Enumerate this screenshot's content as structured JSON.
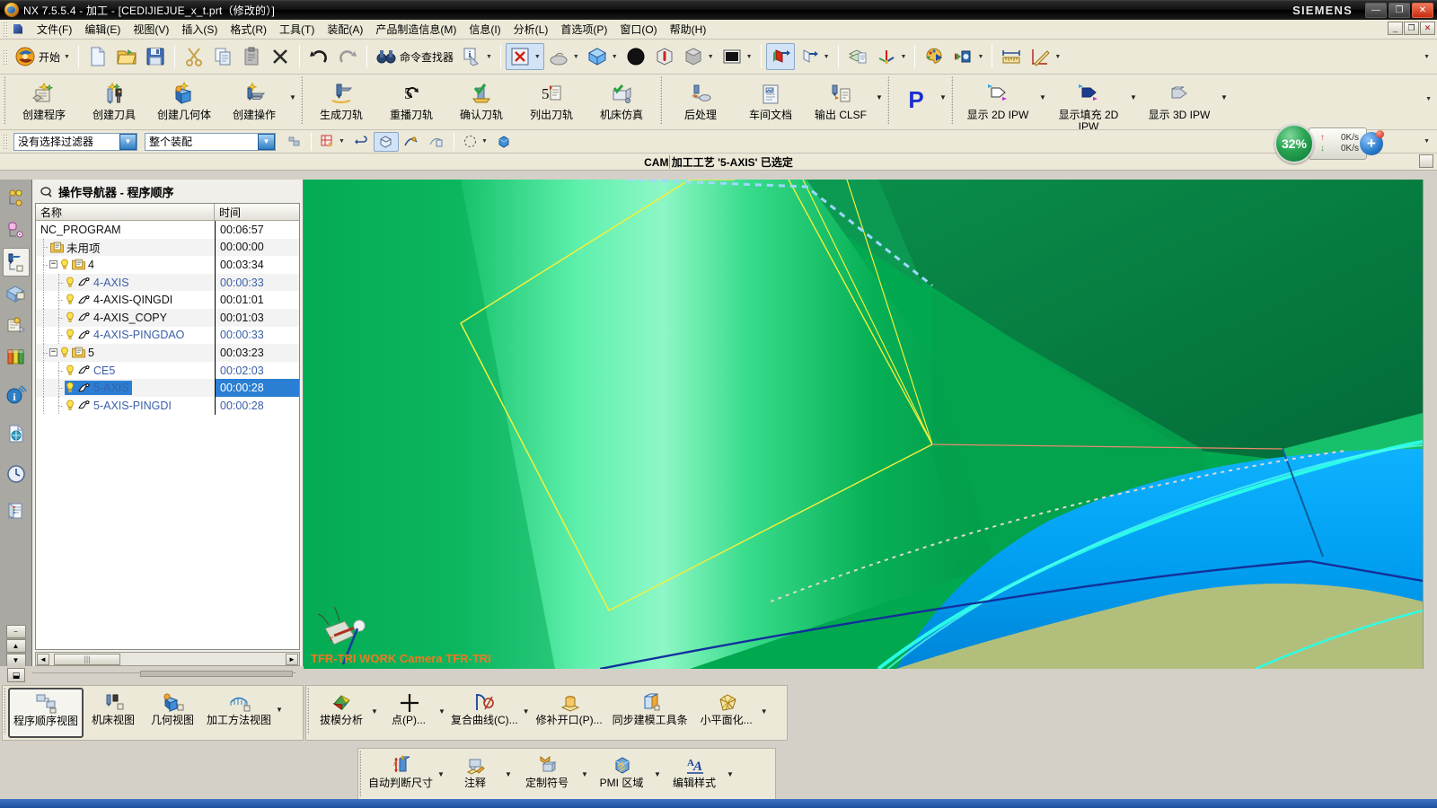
{
  "window": {
    "title": "NX 7.5.5.4 - 加工 - [CEDIJIEJUE_x_t.prt（修改的）]",
    "brand": "SIEMENS",
    "buttons": {
      "minimize": "—",
      "restore": "❐",
      "close": "✕"
    },
    "doc_buttons": {
      "minimize": "_",
      "restore": "❐",
      "close": "✕"
    }
  },
  "menubar": {
    "items": [
      {
        "label": "文件(F)"
      },
      {
        "label": "编辑(E)"
      },
      {
        "label": "视图(V)"
      },
      {
        "label": "插入(S)"
      },
      {
        "label": "格式(R)"
      },
      {
        "label": "工具(T)"
      },
      {
        "label": "装配(A)"
      },
      {
        "label": "产品制造信息(M)"
      },
      {
        "label": "信息(I)"
      },
      {
        "label": "分析(L)"
      },
      {
        "label": "首选项(P)"
      },
      {
        "label": "窗口(O)"
      },
      {
        "label": "帮助(H)"
      }
    ]
  },
  "toolbar_standard": {
    "start_label": "开始",
    "command_finder_label": "命令查找器",
    "items": [
      {
        "name": "start-menu",
        "label": "开始"
      },
      {
        "name": "new-file",
        "label": ""
      },
      {
        "name": "open-file",
        "label": ""
      },
      {
        "name": "save-file",
        "label": ""
      },
      {
        "name": "cut",
        "label": ""
      },
      {
        "name": "copy",
        "label": ""
      },
      {
        "name": "paste",
        "label": ""
      },
      {
        "name": "delete",
        "label": ""
      },
      {
        "name": "undo",
        "label": ""
      },
      {
        "name": "redo",
        "label": ""
      },
      {
        "name": "command-finder",
        "label": "命令查找器"
      },
      {
        "name": "info",
        "label": ""
      }
    ]
  },
  "ribbon": {
    "groups": [
      {
        "name": "create-group",
        "buttons": [
          {
            "icon": "create-program-icon",
            "label": "创建程序"
          },
          {
            "icon": "create-tool-icon",
            "label": "创建刀具"
          },
          {
            "icon": "create-geometry-icon",
            "label": "创建几何体"
          },
          {
            "icon": "create-operation-icon",
            "label": "创建操作"
          }
        ]
      },
      {
        "name": "toolpath-group",
        "buttons": [
          {
            "icon": "generate-toolpath-icon",
            "label": "生成刀轨"
          },
          {
            "icon": "replay-toolpath-icon",
            "label": "重播刀轨"
          },
          {
            "icon": "verify-toolpath-icon",
            "label": "确认刀轨"
          },
          {
            "icon": "list-toolpath-icon",
            "label": "列出刀轨"
          },
          {
            "icon": "machine-simulation-icon",
            "label": "机床仿真"
          }
        ]
      },
      {
        "name": "output-group",
        "buttons": [
          {
            "icon": "postprocess-icon",
            "label": "后处理"
          },
          {
            "icon": "shop-documentation-icon",
            "label": "车间文档"
          },
          {
            "icon": "output-clsf-icon",
            "label": "输出 CLSF"
          }
        ]
      },
      {
        "name": "parallel-group",
        "buttons": [
          {
            "icon": "parallel-generate-icon",
            "label": ""
          }
        ]
      },
      {
        "name": "ipw-group",
        "buttons": [
          {
            "icon": "show-2d-ipw-icon",
            "label": "显示 2D IPW"
          },
          {
            "icon": "show-filled-2d-ipw-icon",
            "label": "显示填充 2D IPW"
          },
          {
            "icon": "show-3d-ipw-icon",
            "label": "显示 3D IPW"
          }
        ]
      }
    ]
  },
  "filterbar": {
    "selection_filter": {
      "value": "没有选择过滤器"
    },
    "scope": {
      "value": "整个装配"
    }
  },
  "cue": {
    "text": "CAM 加工工艺 '5-AXIS' 已选定"
  },
  "resource_bar": {
    "items": [
      {
        "name": "assembly-navigator-icon",
        "title": "装配导航器"
      },
      {
        "name": "part-navigator-icon",
        "title": "部件导航器"
      },
      {
        "name": "operation-navigator-icon",
        "title": "操作导航器",
        "selected": true
      },
      {
        "name": "reuse-library-icon",
        "title": "重用库"
      },
      {
        "name": "roles-icon",
        "title": "角色"
      },
      {
        "name": "system-scenes-icon",
        "title": "系统场景"
      },
      {
        "name": "internet-explorer-icon",
        "title": "Internet Explorer"
      },
      {
        "name": "history-page-icon",
        "title": "历史记录"
      },
      {
        "name": "history-clock-icon",
        "title": "历史"
      },
      {
        "name": "web-browser-icon",
        "title": "Web 浏览器"
      }
    ]
  },
  "navigator": {
    "title": "操作导航器 - 程序顺序",
    "columns": [
      "名称",
      "时间"
    ],
    "rows": [
      {
        "name": "NC_PROGRAM",
        "time": "00:06:57",
        "depth": 0,
        "type": "root",
        "expander": "",
        "warn": false,
        "color": "dark"
      },
      {
        "name": "未用项",
        "time": "00:00:00",
        "depth": 1,
        "type": "program",
        "expander": "",
        "warn": false,
        "color": "dark"
      },
      {
        "name": "4",
        "time": "00:03:34",
        "depth": 1,
        "type": "program",
        "expander": "−",
        "warn": true,
        "color": "dark"
      },
      {
        "name": "4-AXIS",
        "time": "00:00:33",
        "depth": 2,
        "type": "operation",
        "expander": "",
        "warn": true,
        "color": "blue"
      },
      {
        "name": "4-AXIS-QINGDI",
        "time": "00:01:01",
        "depth": 2,
        "type": "operation",
        "expander": "",
        "warn": true,
        "color": "dark"
      },
      {
        "name": "4-AXIS_COPY",
        "time": "00:01:03",
        "depth": 2,
        "type": "operation",
        "expander": "",
        "warn": true,
        "color": "dark"
      },
      {
        "name": "4-AXIS-PINGDAO",
        "time": "00:00:33",
        "depth": 2,
        "type": "operation",
        "expander": "",
        "warn": true,
        "color": "blue"
      },
      {
        "name": "5",
        "time": "00:03:23",
        "depth": 1,
        "type": "program",
        "expander": "−",
        "warn": true,
        "color": "dark"
      },
      {
        "name": "CE5",
        "time": "00:02:03",
        "depth": 2,
        "type": "operation",
        "expander": "",
        "warn": true,
        "color": "blue"
      },
      {
        "name": "5-AXIS",
        "time": "00:00:28",
        "depth": 2,
        "type": "operation",
        "expander": "",
        "warn": true,
        "color": "blue",
        "selected": true
      },
      {
        "name": "5-AXIS-PINGDI",
        "time": "00:00:28",
        "depth": 2,
        "type": "operation",
        "expander": "",
        "warn": true,
        "color": "blue"
      }
    ],
    "scrollbar": {
      "left_arrow": "◄",
      "right_arrow": "►",
      "thumb_label": ""
    }
  },
  "viewport": {
    "triad_label": "TFR-TRI WORK Camera TFR-TRI",
    "colors": {
      "green": "#00a84f",
      "dark_green": "#008f43",
      "blue": "#00a0f0",
      "olive": "#b2bf7c",
      "cyan_highlight": "#00ffd0",
      "yellow_curve": "#ffff00"
    }
  },
  "view_toolbar": {
    "buttons": [
      {
        "icon": "program-order-view-icon",
        "label": "程序顺序视图",
        "selected": true
      },
      {
        "icon": "machine-tool-view-icon",
        "label": "机床视图"
      },
      {
        "icon": "geometry-view-icon",
        "label": "几何视图"
      },
      {
        "icon": "machining-method-view-icon",
        "label": "加工方法视图"
      }
    ]
  },
  "analysis_toolbar": {
    "buttons": [
      {
        "icon": "draft-analysis-icon",
        "label": "拔模分析",
        "dropdown": true
      },
      {
        "icon": "point-icon",
        "label": "点(P)...",
        "dropdown": true
      },
      {
        "icon": "composite-curve-icon",
        "label": "复合曲线(C)...",
        "dropdown": true
      },
      {
        "icon": "patch-opening-icon",
        "label": "修补开口(P)...",
        "dropdown": false
      },
      {
        "icon": "synchronous-modeling-icon",
        "label": "同步建模工具条",
        "dropdown": false
      },
      {
        "icon": "planarize-icon",
        "label": "小平面化...",
        "dropdown": true
      }
    ]
  },
  "pmi_toolbar": {
    "buttons": [
      {
        "icon": "inferred-dimension-icon",
        "label": "自动判断尺寸",
        "dropdown": true
      },
      {
        "icon": "note-icon",
        "label": "注释",
        "dropdown": true
      },
      {
        "icon": "custom-symbol-icon",
        "label": "定制符号",
        "dropdown": true
      },
      {
        "icon": "pmi-region-icon",
        "label": "PMI 区域",
        "dropdown": true
      },
      {
        "icon": "edit-style-icon",
        "label": "编辑样式",
        "dropdown": true
      }
    ]
  },
  "gadget": {
    "percent": "32%",
    "upload": "0K/s",
    "download": "0K/s",
    "up_arrow": "↑",
    "down_arrow": "↓",
    "plus": "+"
  }
}
